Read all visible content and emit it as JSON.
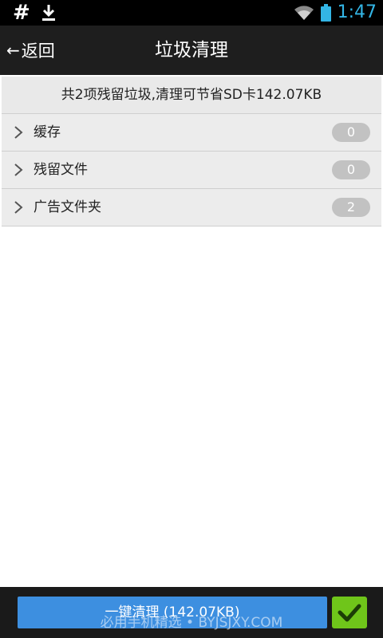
{
  "status_bar": {
    "left_icons": [
      "hash-icon",
      "download-icon"
    ],
    "hash_glyph": "#",
    "right_icons": [
      "wifi-icon",
      "battery-icon"
    ],
    "time": "1:47"
  },
  "header": {
    "back_label": "返回",
    "title": "垃圾清理"
  },
  "summary": "共2项残留垃圾,清理可节省SD卡142.07KB",
  "rows": [
    {
      "label": "缓存",
      "count": "0"
    },
    {
      "label": "残留文件",
      "count": "0"
    },
    {
      "label": "广告文件夹",
      "count": "2"
    }
  ],
  "footer": {
    "clean_button_label": "一键清理 (142.07KB)",
    "confirm_icon": "check-icon",
    "watermark": "必用手机精选 • BYJSJXY.COM"
  },
  "colors": {
    "accent_blue": "#3d8fe0",
    "confirm_green": "#6fc51a",
    "time_blue": "#33b5e5",
    "badge_gray": "#c2c2c2"
  }
}
